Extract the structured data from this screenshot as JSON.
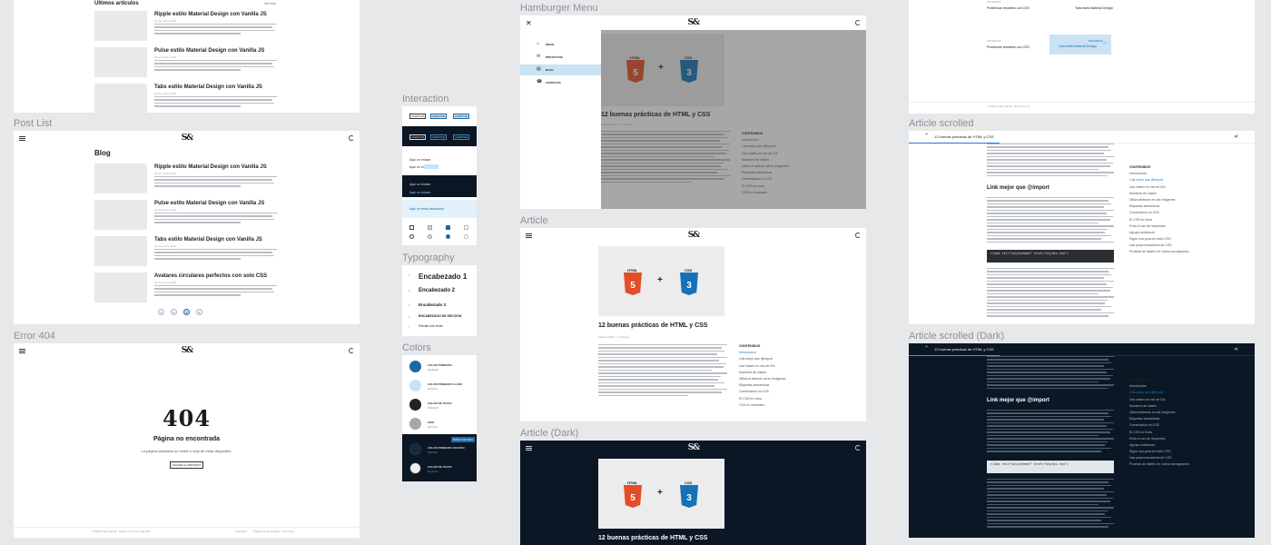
{
  "labels": {
    "post_list": "Post List",
    "error_404": "Error 404",
    "interaction": "Interaction",
    "typography": "Typography",
    "colors": "Colors",
    "hamburger_menu": "Hamburger Menu",
    "article": "Article",
    "article_dark": "Article (Dark)",
    "article_scrolled": "Article scrolled",
    "article_scrolled_dark": "Article scrolled (Dark)"
  },
  "home": {
    "section_title": "Últimos artículos",
    "see_more": "Ver más",
    "posts": [
      {
        "title": "Ripple estilo Material Design con Vanilla JS",
        "date": "20 de marzo 2021"
      },
      {
        "title": "Pulse estilo Material Design con Vanilla JS",
        "date": "20 de marzo 2021"
      },
      {
        "title": "Tabs estilo Material Design con Vanilla JS",
        "date": "20 de marzo 2021"
      }
    ]
  },
  "post_list": {
    "heading": "Blog",
    "posts": [
      {
        "title": "Ripple estilo Material Design con Vanilla JS",
        "date": "20 de marzo 2021"
      },
      {
        "title": "Pulse estilo Material Design con Vanilla JS",
        "date": "20 de marzo 2021"
      },
      {
        "title": "Tabs estilo Material Design con Vanilla JS",
        "date": "20 de marzo 2021"
      },
      {
        "title": "Avatares circulares perfectos con solo CSS",
        "date": "20 de marzo 2021"
      }
    ],
    "pages": [
      "1",
      "2",
      "3",
      "4"
    ]
  },
  "error404": {
    "code": "404",
    "title": "Página no encontrada",
    "text": "La página solicitada no existe o dejó de estar disponible.",
    "button": "VOLVER AL PRINCIPIO",
    "footer_left": "© 2021 Felipe Santa · Hecho con ♥ en Colombia",
    "footer_links": [
      "Copyright",
      "Política de privacidad",
      "Términos"
    ]
  },
  "interaction": {
    "buttons": [
      "ACEPTAR",
      "ACEPTAR",
      "ACEPTAR"
    ],
    "link_normal": "Aquí un enlace",
    "link_hover": "Aquí un enlace",
    "link_alt": "Aquí un texto destacado"
  },
  "typography": {
    "items": [
      {
        "tag": "h1",
        "text": "Encabezado 1"
      },
      {
        "tag": "h2",
        "text": "Encabezado 2"
      },
      {
        "tag": "h3",
        "text": "Encabezado 3"
      },
      {
        "tag": "h4",
        "text": "ENCABEZADO DE SECCIÓN"
      },
      {
        "tag": "p",
        "text": "Párrafo con texto"
      }
    ]
  },
  "colors": {
    "items": [
      {
        "name": "COLOR PRIMARIO",
        "hex": "#1a6aa8"
      },
      {
        "name": "COLOR PRIMARIO CLARO",
        "hex": "#c9e3f4"
      },
      {
        "name": "COLOR DE TEXTO",
        "hex": "#222222"
      },
      {
        "name": "GRIS",
        "hex": "#a7a7a7"
      }
    ],
    "dark_items": [
      {
        "name": "COLOR PRIMARIO OSCURO",
        "hex": "#0f2a44"
      },
      {
        "name": "COLOR DE TEXTO",
        "hex": "#eeeeee"
      }
    ],
    "dark_badge": "MODO OSCURO"
  },
  "menu": {
    "items": [
      "INICIO",
      "PROYECTOS",
      "BLOG",
      "CONTACTO"
    ],
    "active": "BLOG"
  },
  "article": {
    "title": "12 buenas prácticas de HTML y CSS",
    "meta": "6 Enero 2021 · 7 minutos",
    "html_label": "HTML",
    "css_label": "CSS",
    "html_num": "5",
    "css_num": "3",
    "plus": "+",
    "toc_title": "CONTENIDOS",
    "toc": [
      "Introducción",
      "Link mejor que @import",
      "Usa clases en vez de IDs",
      "Nombres de clases",
      "Utiliza el atributo alt en imágenes",
      "Etiquetas semánticas",
      "Comentarios en CSS",
      "El CSS en línea",
      "CSS no necesario"
    ]
  },
  "scrolled": {
    "top_title": "12 buenas prácticas de HTML y CSS",
    "section_heading": "Link mejor que @import",
    "code": "<link rel=\"stylesheet\" href=\"styles.css\">",
    "toc_title": "CONTENIDOS",
    "toc": [
      "Introducción",
      "Link mejor que @import",
      "Usa clases en vez de IDs",
      "Nombres de clases",
      "Utiliza atributos en las imágenes",
      "Etiquetas semánticas",
      "Comentarios en CSS",
      "El CSS en línea",
      "Evita el uso de !important",
      "Agrupa selectores",
      "Sigue una guía de estilo CSS",
      "Usa preprocesadores de CSS",
      "Pruebas de diseño en varios navegadores"
    ]
  },
  "top_right": {
    "prev_label": "ANTERIOR",
    "prev_title": "Problemas resueltos con CSS",
    "next_label": "SIGUIENTE",
    "next_title": "Tabs estilo Material Design",
    "prev2_title": "Problemas resueltos con CSS",
    "next2_title": "Tabs estilo Material Design",
    "footer": "© 2021 Felipe Santa · Hecho con ♥"
  }
}
